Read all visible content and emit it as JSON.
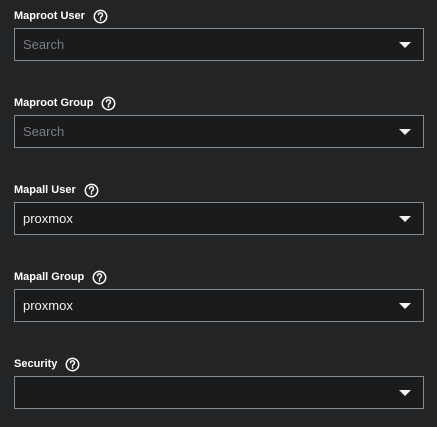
{
  "fields": [
    {
      "label": "Maproot User",
      "value": "",
      "placeholder": "Search",
      "help_icon": "question-circle-icon",
      "caret_icon": "caret-down-icon"
    },
    {
      "label": "Maproot Group",
      "value": "",
      "placeholder": "Search",
      "help_icon": "question-circle-icon",
      "caret_icon": "caret-down-icon"
    },
    {
      "label": "Mapall User",
      "value": "proxmox",
      "placeholder": "",
      "help_icon": "question-circle-icon",
      "caret_icon": "caret-down-icon"
    },
    {
      "label": "Mapall Group",
      "value": "proxmox",
      "placeholder": "",
      "help_icon": "question-circle-icon",
      "caret_icon": "caret-down-icon"
    },
    {
      "label": "Security",
      "value": "",
      "placeholder": "",
      "help_icon": "question-circle-icon",
      "caret_icon": "caret-down-icon"
    }
  ],
  "colors": {
    "background": "#222425",
    "field_background": "#1a1b1c",
    "field_border": "#868a8c",
    "label_text": "#ffffff",
    "value_text": "#f0f0f0",
    "placeholder_text": "#7a7d80"
  }
}
